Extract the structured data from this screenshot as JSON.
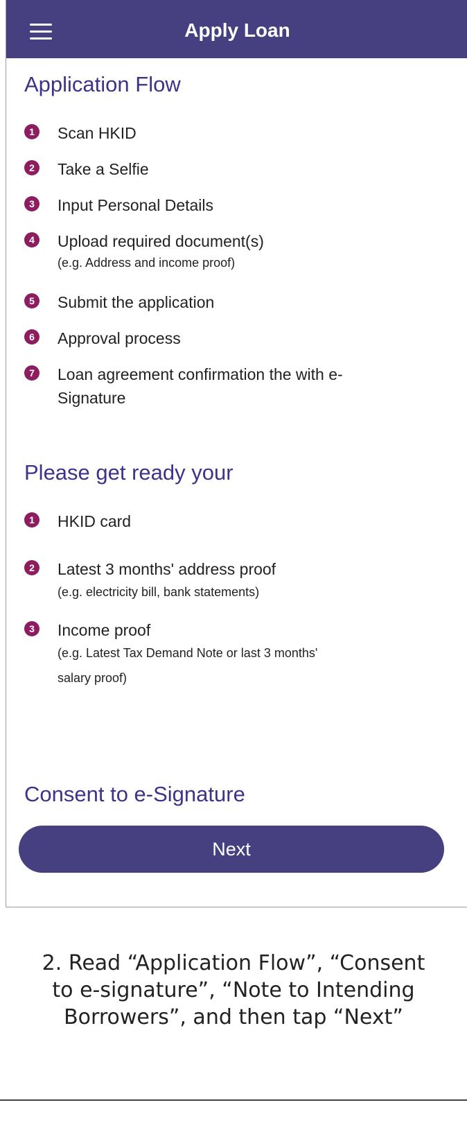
{
  "header": {
    "title": "Apply Loan",
    "menu_icon": "hamburger-menu-icon"
  },
  "application_flow": {
    "title": "Application Flow",
    "steps": [
      {
        "number": "1",
        "label": "Scan HKID",
        "note": ""
      },
      {
        "number": "2",
        "label": "Take a Selfie",
        "note": ""
      },
      {
        "number": "3",
        "label": "Input Personal Details",
        "note": ""
      },
      {
        "number": "4",
        "label": "Upload required document(s)",
        "note": "(e.g. Address and income proof)"
      },
      {
        "number": "5",
        "label": "Submit the application",
        "note": ""
      },
      {
        "number": "6",
        "label": "Approval process",
        "note": ""
      },
      {
        "number": "7",
        "label_line1": "Loan agreement confirmation the with e-",
        "label_line2": "Signature"
      }
    ]
  },
  "get_ready": {
    "title": "Please get ready your",
    "items": [
      {
        "number": "1",
        "label": "HKID card"
      },
      {
        "number": "2",
        "label": "Latest 3 months' address proof",
        "note": "(e.g. electricity bill, bank statements)"
      },
      {
        "number": "3",
        "label": "Income proof",
        "note_line1": "(e.g. Latest Tax Demand Note or last 3 months'",
        "note_line2": "salary proof)"
      }
    ]
  },
  "consent": {
    "title": "Consent to e-Signature"
  },
  "next_button": {
    "label": "Next"
  },
  "caption": {
    "line1": "2. Read “Application Flow”, “Consent",
    "line2": "to e-signature”, “Note to Intending",
    "line3": "Borrowers”, and then tap “Next”"
  },
  "colors": {
    "header_bg": "#463f80",
    "section_title": "#3b3489",
    "badge": "#8d1d5e",
    "button_bg": "#463f80"
  }
}
